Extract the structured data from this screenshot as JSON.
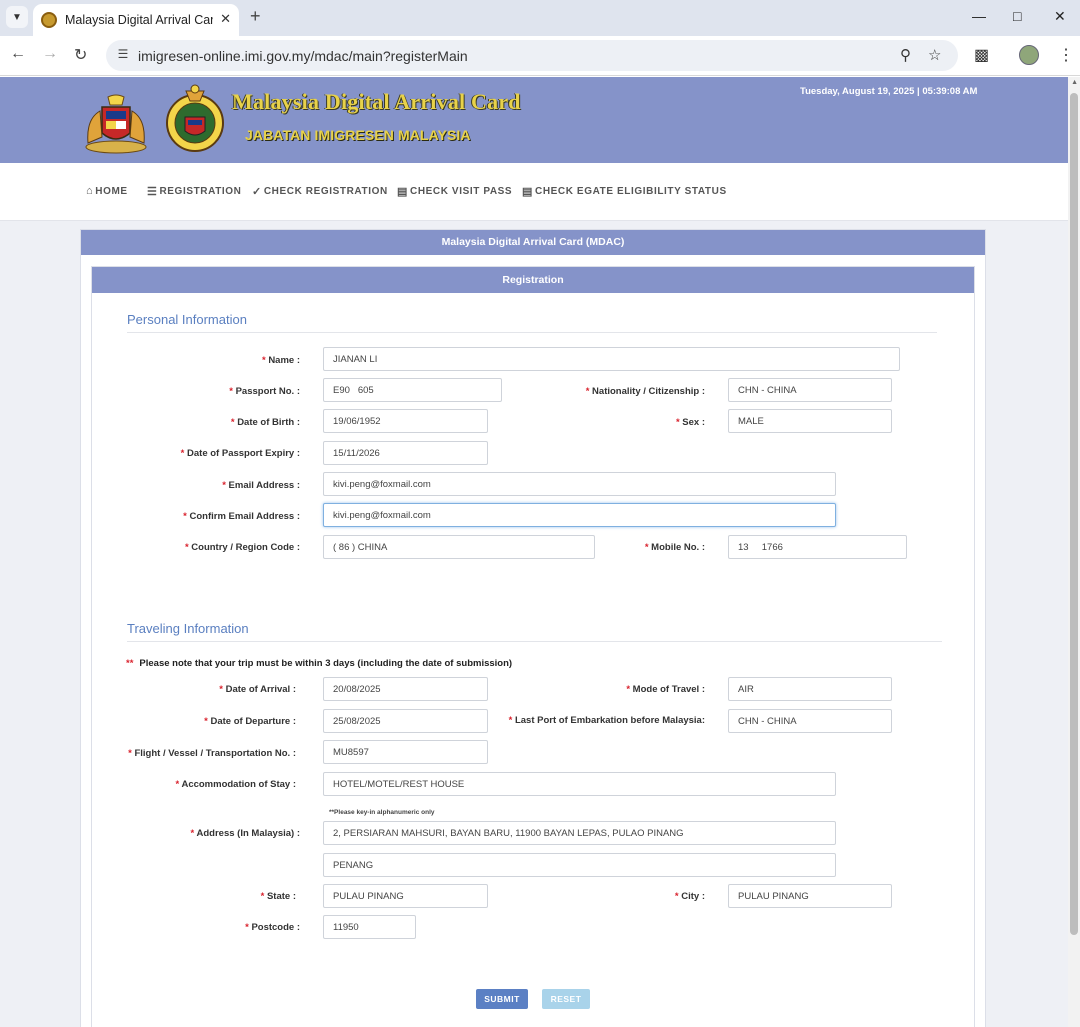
{
  "browser": {
    "tab_title": "Malaysia Digital Arrival Card",
    "url": "imigresen-online.imi.gov.my/mdac/main?registerMain"
  },
  "header": {
    "title": "Malaysia Digital Arrival Card",
    "subtitle": "JABATAN IMIGRESEN MALAYSIA",
    "datetime": "Tuesday, August 19, 2025 | 05:39:08 AM"
  },
  "nav": {
    "home": "HOME",
    "registration": "REGISTRATION",
    "check_registration": "CHECK REGISTRATION",
    "check_visit_pass": "CHECK VISIT PASS",
    "check_egate": "CHECK EGATE ELIGIBILITY STATUS"
  },
  "panel": {
    "title": "Malaysia Digital Arrival Card (MDAC)",
    "subtitle": "Registration"
  },
  "personal": {
    "section_title": "Personal Information",
    "name_label": "Name :",
    "name_value": "JIANAN LI",
    "passport_label": "Passport No. :",
    "passport_value": "E90   605",
    "nationality_label": "Nationality / Citizenship :",
    "nationality_value": "CHN - CHINA",
    "dob_label": "Date of Birth :",
    "dob_value": "19/06/1952",
    "sex_label": "Sex :",
    "sex_value": "MALE",
    "passport_expiry_label": "Date of Passport Expiry :",
    "passport_expiry_value": "15/11/2026",
    "email_label": "Email Address :",
    "email_value": "kivi.peng@foxmail.com",
    "confirm_email_label": "Confirm Email Address :",
    "confirm_email_value": "kivi.peng@foxmail.com",
    "country_code_label": "Country / Region Code :",
    "country_code_value": "( 86 ) CHINA",
    "mobile_label": "Mobile No. :",
    "mobile_value": "13     1766"
  },
  "travel": {
    "section_title": "Traveling Information",
    "note_marker": "**",
    "note": "Please note that your trip must be within 3 days (including the date of submission)",
    "arrival_label": "Date of Arrival :",
    "arrival_value": "20/08/2025",
    "mode_label": "Mode of Travel :",
    "mode_value": "AIR",
    "departure_label": "Date of Departure :",
    "departure_value": "25/08/2025",
    "last_port_label": "Last Port of Embarkation before Malaysia:",
    "last_port_value": "CHN - CHINA",
    "flight_label": "Flight / Vessel / Transportation No. :",
    "flight_value": "MU8597",
    "accommodation_label": "Accommodation of Stay :",
    "accommodation_value": "HOTEL/MOTEL/REST HOUSE",
    "address_hint": "**Please key-in alphanumeric only",
    "address_label": "Address (In Malaysia) :",
    "address_line1": "2, PERSIARAN MAHSURI, BAYAN BARU, 11900 BAYAN LEPAS, PULAO PINANG",
    "address_line2": "PENANG",
    "state_label": "State :",
    "state_value": "PULAU PINANG",
    "city_label": "City :",
    "city_value": "PULAU PINANG",
    "postcode_label": "Postcode :",
    "postcode_value": "11950"
  },
  "actions": {
    "submit": "SUBMIT",
    "reset": "RESET"
  },
  "required_marker": "*",
  "icons": [
    "tab-list-icon",
    "favicon-icon",
    "close-icon",
    "plus-icon",
    "minimize-icon",
    "maximize-icon",
    "window-close-icon",
    "back-icon",
    "forward-icon",
    "reload-icon",
    "site-info-icon",
    "zoom-icon",
    "star-icon",
    "extensions-icon",
    "avatar",
    "menu-icon",
    "home-icon",
    "list-icon",
    "check-icon",
    "document-icon"
  ]
}
